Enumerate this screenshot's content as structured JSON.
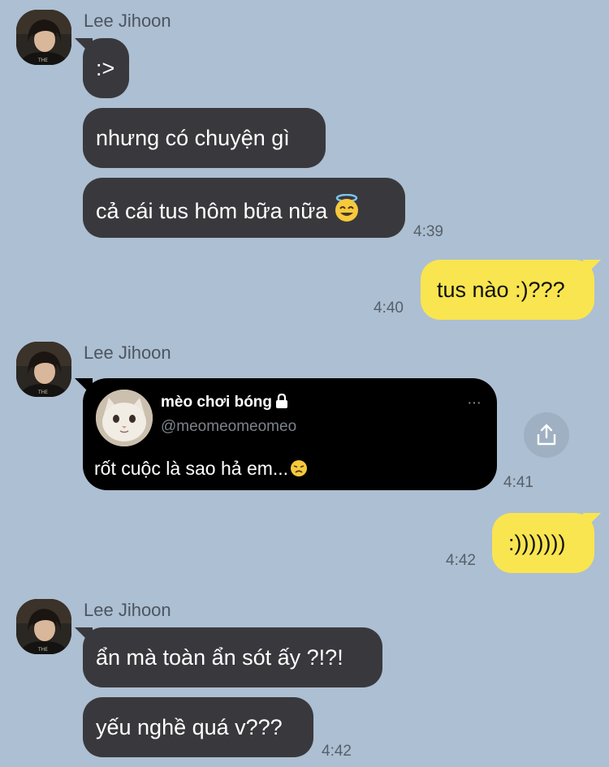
{
  "contact": {
    "name": "Lee Jihoon"
  },
  "groups": [
    {
      "sender": "Lee Jihoon",
      "messages": [
        ":>",
        "nhưng có chuyện gì",
        "cả cái tus hôm bữa nữa"
      ],
      "last_emoji": "halo-smile-emoji",
      "time": "4:39"
    },
    {
      "sender": "Lee Jihoon",
      "shared_post": {
        "account_name": "mèo chơi bóng",
        "handle": "@meomeomeomeo",
        "text": "rốt cuộc là sao hả em...",
        "text_emoji": "disappointed-face-emoji",
        "more": "···"
      },
      "time": "4:41"
    },
    {
      "sender": "Lee Jihoon",
      "messages": [
        "ẩn mà toàn ẩn sót ấy ?!?!",
        "yếu nghề quá v???"
      ],
      "time": "4:42"
    }
  ],
  "outgoing": [
    {
      "text": "tus nào :)???",
      "time": "4:40"
    },
    {
      "text": ":)))))))",
      "time": "4:42"
    }
  ],
  "colors": {
    "background": "#adbfd2",
    "incoming_bubble": "#39393d",
    "outgoing_bubble": "#f9e54f",
    "card": "#000000"
  },
  "icons": {
    "share": "share-icon",
    "lock": "lock-icon"
  }
}
